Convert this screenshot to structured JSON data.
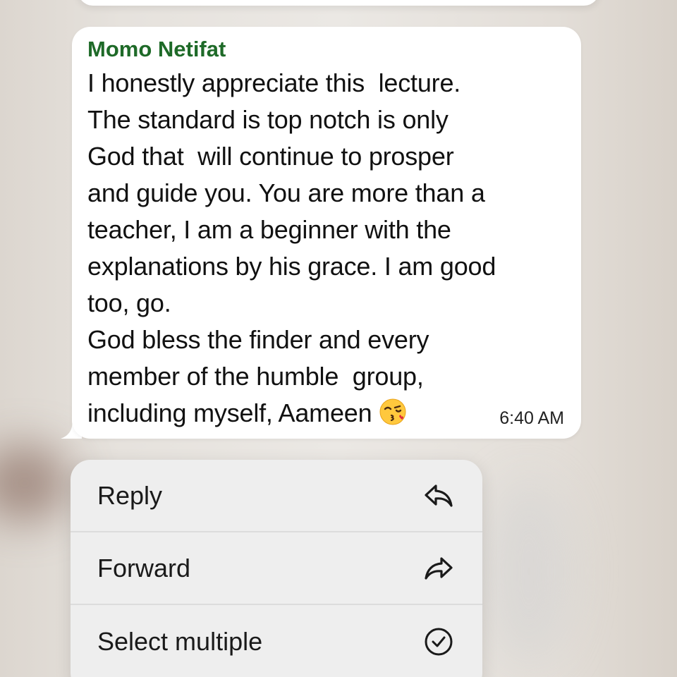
{
  "message": {
    "sender": "Momo Netifat",
    "lines": [
      "I honestly appreciate this  lecture.",
      "The standard is top notch is only",
      "God that  will continue to prosper",
      "and guide you. You are more than a",
      "teacher, I am a beginner with the",
      "explanations by his grace. I am good",
      "too, go.",
      "God bless the finder and every",
      "member of the humble  group,",
      "including myself, Aameen"
    ],
    "emoji": "kissing-face-emoji",
    "time": "6:40 AM",
    "sender_color": "#1e6a28"
  },
  "menu": {
    "items": [
      {
        "label": "Reply",
        "icon": "reply-icon"
      },
      {
        "label": "Forward",
        "icon": "forward-icon"
      },
      {
        "label": "Select multiple",
        "icon": "check-circle-icon"
      }
    ]
  }
}
